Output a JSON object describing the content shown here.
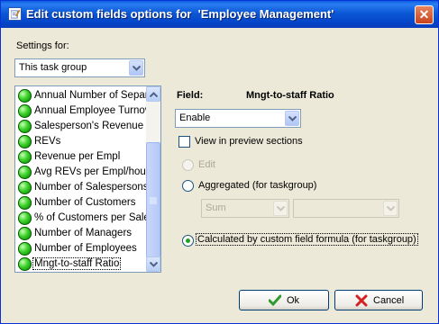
{
  "window": {
    "title": "Edit custom fields options for  'Employee Management'"
  },
  "settings": {
    "label": "Settings for:",
    "selected": "This task group"
  },
  "fields_list": {
    "items": [
      {
        "label": "Annual Number of  Separa"
      },
      {
        "label": "Annual Employee Turnove"
      },
      {
        "label": "Salesperson's Revenue"
      },
      {
        "label": "REVs"
      },
      {
        "label": "Revenue per Empl"
      },
      {
        "label": "Avg REVs per Empl/hour"
      },
      {
        "label": "Number of Salespersons"
      },
      {
        "label": "Number of Customers"
      },
      {
        "label": "% of Customers per Salesp"
      },
      {
        "label": "Number of Managers"
      },
      {
        "label": "Number of Employees"
      },
      {
        "label": "Mngt-to-staff Ratio"
      }
    ],
    "selected_index": 11
  },
  "field": {
    "label": "Field:",
    "name": "Mngt-to-staff Ratio"
  },
  "state_select": {
    "selected": "Enable"
  },
  "preview": {
    "label": "View in preview sections",
    "checked": false
  },
  "options": {
    "edit_label": "Edit",
    "aggregated_label": "Aggregated (for taskgroup)",
    "aggregate_function": "Sum",
    "aggregate_target": "",
    "calculated_label": "Calculated by custom field formula (for taskgroup)",
    "selected": "calculated"
  },
  "buttons": {
    "ok": "Ok",
    "cancel": "Cancel"
  },
  "colors": {
    "title_bar": "#0b58d6",
    "dialog_bg": "#ece9d8",
    "ok_icon": "#2e9b2e",
    "cancel_icon": "#d42020",
    "status_dot": "#3ed22a"
  }
}
